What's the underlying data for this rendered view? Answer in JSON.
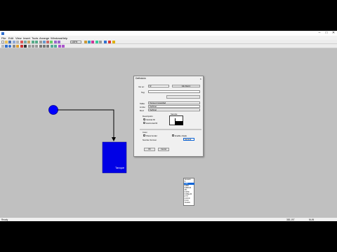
{
  "window": {
    "title": "",
    "minimize": "–",
    "maximize": "□",
    "close": "✕"
  },
  "menu": [
    "File",
    "Edit",
    "View",
    "Insert",
    "Tools",
    "Arrange",
    "Windows",
    "Help"
  ],
  "toolbar": {
    "zoom": "100%",
    "style_combo": ""
  },
  "diagram": {
    "tank_label": "Tanque",
    "circle_color": "#0000ff",
    "tank_color": "#0000e6"
  },
  "dialog": {
    "title": "Definición",
    "fields": {
      "row1_label": "Ver en:",
      "row1_value": "Nº",
      "row1_button": "Vãy Ruit-V",
      "row2_label": "Tag:",
      "row2_value": "",
      "row2_button": "",
      "row3_label": "Tabla:",
      "row3_value": "Tanque1.Capacidad",
      "row4_label": "Límite:",
      "row4_value": "TagNivel",
      "row5_label": "Mod:",
      "row5_value": "TagNivel"
    },
    "group_label": "Descripción",
    "radio1": "Vertical fill",
    "radio2": "Horizontal fill",
    "preview_label": "Sample",
    "section_label": "Color",
    "check1": "Show border",
    "check2": "Enable shade",
    "number_label": "Number Format",
    "number_value": "General",
    "ok": "OK",
    "cancel": "Cancel"
  },
  "dropdown": {
    "options": [
      "General",
      "0",
      "0.00",
      "#,##0",
      "#,##0.00",
      "0%",
      "0.00%",
      "0.00E+00",
      "# ?/?",
      "d-mmm",
      "h:mm",
      "Custom"
    ],
    "selected_index": 2
  },
  "status": {
    "left": "Ready",
    "right1": "383,197",
    "right2": "NUM"
  }
}
